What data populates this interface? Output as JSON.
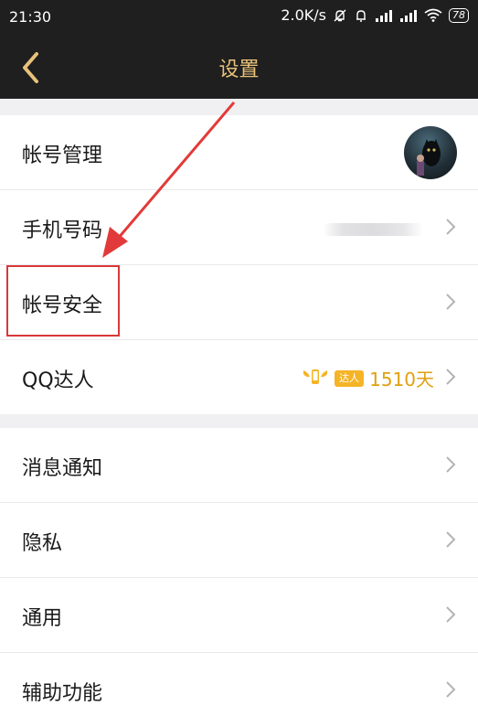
{
  "status_bar": {
    "time": "21:30",
    "net_speed": "2.0K/s",
    "battery": "78"
  },
  "nav": {
    "title": "设置"
  },
  "group1": [
    {
      "label": "帐号管理"
    },
    {
      "label": "手机号码"
    },
    {
      "label": "帐号安全"
    },
    {
      "label": "QQ达人",
      "badge": "达人",
      "days": "1510天"
    }
  ],
  "group2": [
    {
      "label": "消息通知"
    },
    {
      "label": "隐私"
    },
    {
      "label": "通用"
    },
    {
      "label": "辅助功能"
    }
  ],
  "colors": {
    "bar_bg": "#1f1f1f",
    "accent_gold": "#e8c27a",
    "annotation_red": "#d9383a"
  }
}
